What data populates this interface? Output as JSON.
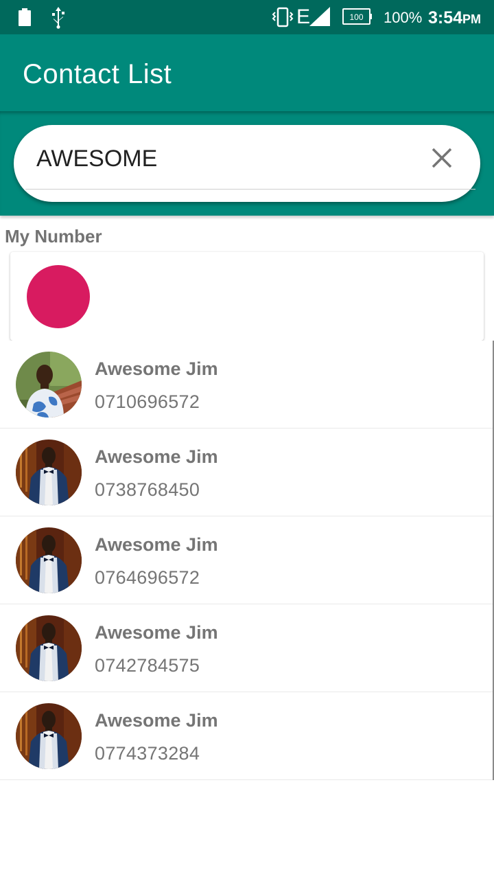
{
  "status_bar": {
    "network_type": "E",
    "battery_box_label": "100",
    "battery_percent": "100%",
    "time": "3:54",
    "ampm": "PM",
    "icons": [
      "battery-icon",
      "usb-icon",
      "vibrate-icon",
      "signal-icon",
      "battery-level-icon"
    ]
  },
  "toolbar": {
    "title": "Contact List"
  },
  "search": {
    "value": "AWESOME",
    "clear_icon": "close-icon"
  },
  "my_number": {
    "label": "My Number",
    "avatar_color": "#d81b60"
  },
  "contacts": [
    {
      "name": "Awesome Jim",
      "phone": "0710696572",
      "avatar": "photo-casual"
    },
    {
      "name": "Awesome Jim",
      "phone": "0738768450",
      "avatar": "photo-suit"
    },
    {
      "name": "Awesome Jim",
      "phone": "0764696572",
      "avatar": "photo-suit"
    },
    {
      "name": "Awesome Jim",
      "phone": "0742784575",
      "avatar": "photo-suit"
    },
    {
      "name": "Awesome Jim",
      "phone": "0774373284",
      "avatar": "photo-suit"
    }
  ],
  "colors": {
    "status_bar": "#00695c",
    "primary": "#00897b",
    "accent": "#d81b60",
    "text_secondary": "#757575"
  }
}
